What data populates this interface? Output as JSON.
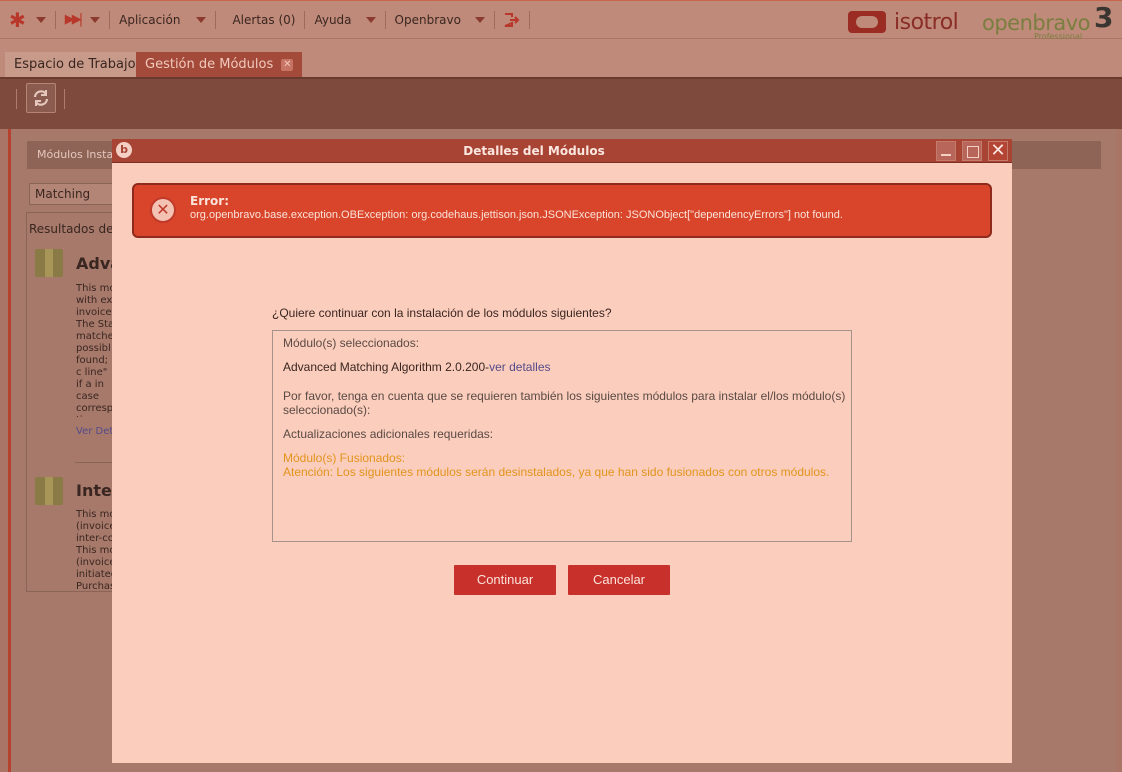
{
  "navbar": {
    "application": "Aplicación",
    "alerts": "Alertas (0)",
    "help": "Ayuda",
    "openbravo": "Openbravo"
  },
  "brand": {
    "isotrol": "isotrol",
    "openbravo": "openbravo",
    "openbravo_edition": "Professional",
    "openbravo_version": "3"
  },
  "tabs": [
    {
      "label": "Espacio de Trabajo",
      "active": false
    },
    {
      "label": "Gestión de Módulos",
      "active": true
    }
  ],
  "background": {
    "header": "Módulos Instala",
    "select_value": "Matching",
    "results_label": "Resultados de la",
    "modules": [
      {
        "title": "Adva",
        "desc": "This mc with exi invoices The Sta matche possibl found; c line\" if a in case corresp time.",
        "link": "Ver Det"
      },
      {
        "title": "Inter-",
        "desc": "This mc (invoice inter-co This mc (invoice initiated Purchas"
      }
    ]
  },
  "dialog": {
    "title": "Detalles del Módulos",
    "error": {
      "label": "Error:",
      "message": "org.openbravo.base.exception.OBException: org.codehaus.jettison.json.JSONException: JSONObject[\"dependencyErrors\"] not found."
    },
    "question": "¿Quiere continuar con la instalación de los módulos siguientes?",
    "details": {
      "selected_heading": "Módulo(s) seleccionados:",
      "selected_module": "Advanced Matching Algorithm 2.0.200-",
      "details_link": "ver detalles",
      "note": "Por favor, tenga en cuenta que se requieren también los siguientes módulos para instalar el/los módulo(s) seleccionado(s):",
      "updates_heading": "Actualizaciones adicionales requeridas:",
      "merged_heading": "Módulo(s) Fusionados:",
      "merged_warning": "Atención: Los siguientes módulos serán desinstalados, ya que han sido fusionados con otros módulos."
    },
    "buttons": {
      "continue": "Continuar",
      "cancel": "Cancelar"
    }
  },
  "colors": {
    "accent": "#c8302c",
    "dialog_bg": "#fbcdbd",
    "error_bg": "#d8452a",
    "warning_text": "#e2941c",
    "link": "#544b8a"
  }
}
